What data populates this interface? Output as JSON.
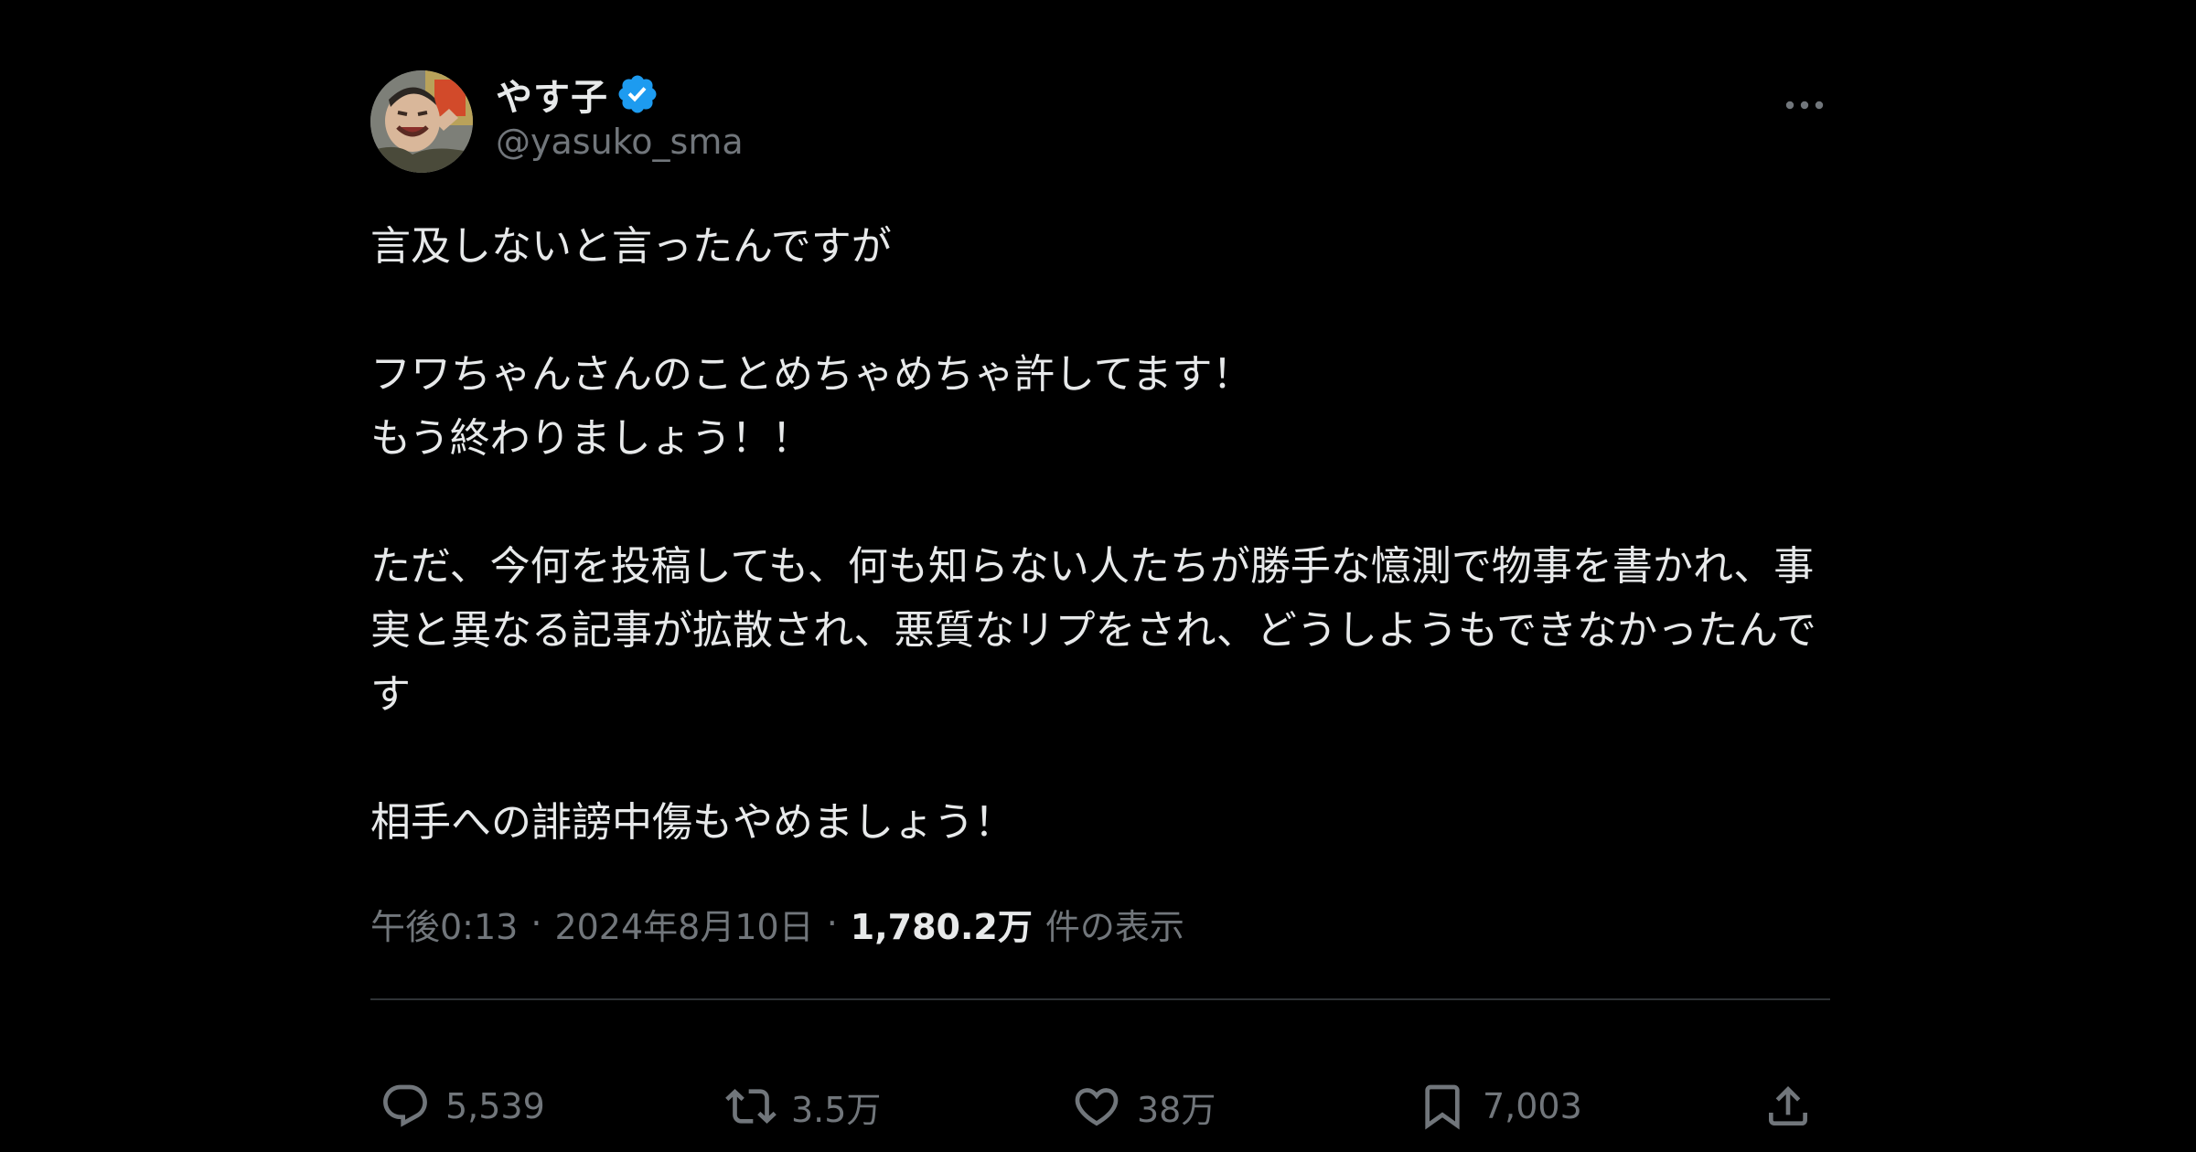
{
  "tweet": {
    "author": {
      "display_name": "やす子",
      "handle": "@yasuko_sma",
      "verified_icon": "verified-badge-icon",
      "verified_color": "#1d9bf0"
    },
    "more_icon": "more-horizontal-icon",
    "text": "言及しないと言ったんですが\n\nフワちゃんさんのことめちゃめちゃ許してます！\nもう終わりましょう！！\n\nただ、今何を投稿しても、何も知らない人たちが勝手な憶測で物事を書かれ、事実と異なる記事が拡散され、悪質なリプをされ、どうしようもできなかったんです\n\n相手への誹謗中傷もやめましょう！",
    "meta": {
      "time": "午後0:13",
      "separator": "·",
      "date": "2024年8月10日",
      "views_count": "1,780.2万",
      "views_label": "件の表示"
    },
    "actions": {
      "reply": {
        "icon": "reply-icon",
        "count": "5,539"
      },
      "repost": {
        "icon": "repost-icon",
        "count": "3.5万"
      },
      "like": {
        "icon": "heart-icon",
        "count": "38万"
      },
      "bookmark": {
        "icon": "bookmark-icon",
        "count": "7,003"
      },
      "share": {
        "icon": "share-icon"
      }
    }
  },
  "colors": {
    "background": "#000000",
    "text_primary": "#e7e9ea",
    "text_secondary": "#71767b",
    "divider": "#2f3336",
    "accent": "#1d9bf0"
  }
}
